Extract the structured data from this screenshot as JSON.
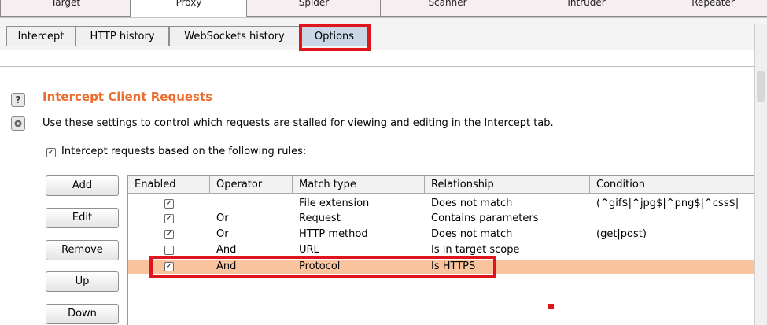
{
  "top_tabs": [
    {
      "label": "Target"
    },
    {
      "label": "Proxy"
    },
    {
      "label": "Spider"
    },
    {
      "label": "Scanner"
    },
    {
      "label": "Intruder"
    },
    {
      "label": "Repeater"
    }
  ],
  "sub_tabs": [
    {
      "label": "Intercept"
    },
    {
      "label": "HTTP history"
    },
    {
      "label": "WebSockets history"
    },
    {
      "label": "Options"
    }
  ],
  "section": {
    "title": "Intercept Client Requests",
    "description": "Use these settings to control which requests are stalled for viewing and editing in the Intercept tab.",
    "help_icon": "?",
    "settings_icon": "gear-icon"
  },
  "intercept_rule_checkbox": {
    "label": "Intercept requests based on the following rules:",
    "checked": true
  },
  "buttons": {
    "add": "Add",
    "edit": "Edit",
    "remove": "Remove",
    "up": "Up",
    "down": "Down"
  },
  "table": {
    "headers": [
      "Enabled",
      "Operator",
      "Match type",
      "Relationship",
      "Condition"
    ],
    "rows": [
      {
        "enabled": true,
        "operator": "",
        "match_type": "File extension",
        "relationship": "Does not match",
        "condition": "(^gif$|^jpg$|^png$|^css$|"
      },
      {
        "enabled": true,
        "operator": "Or",
        "match_type": "Request",
        "relationship": "Contains parameters",
        "condition": ""
      },
      {
        "enabled": true,
        "operator": "Or",
        "match_type": "HTTP method",
        "relationship": "Does not match",
        "condition": "(get|post)"
      },
      {
        "enabled": false,
        "operator": "And",
        "match_type": "URL",
        "relationship": "Is in target scope",
        "condition": ""
      },
      {
        "enabled": true,
        "operator": "And",
        "match_type": "Protocol",
        "relationship": "Is HTTPS",
        "condition": ""
      }
    ]
  },
  "colors": {
    "accent": "#ec6d2f",
    "highlight": "#e0141c",
    "selected_row": "#f9c49d",
    "active_subtab": "#c9d6e3"
  }
}
